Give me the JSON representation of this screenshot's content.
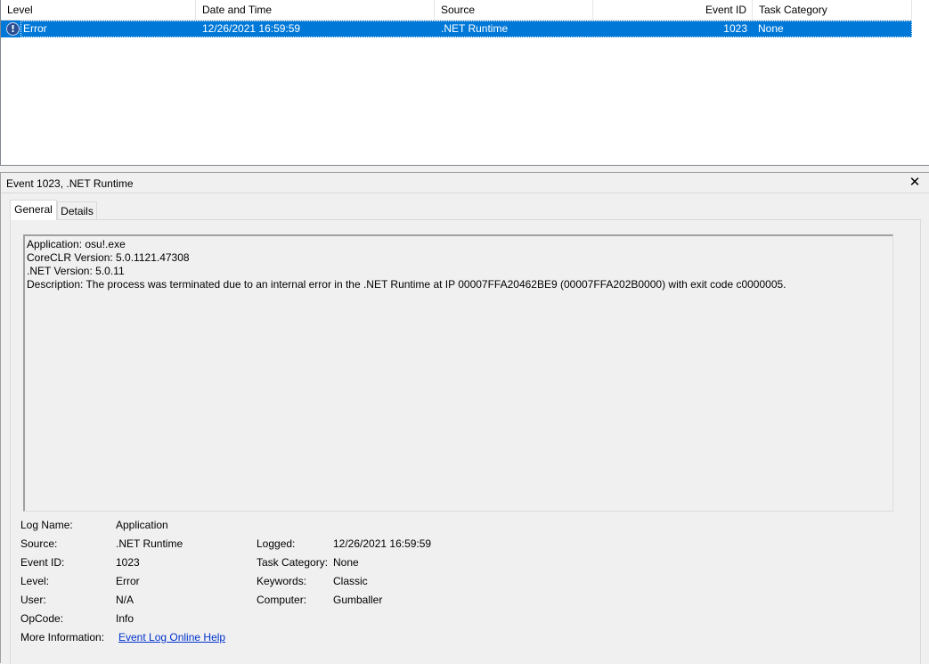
{
  "list": {
    "columns": [
      "Level",
      "Date and Time",
      "Source",
      "Event ID",
      "Task Category"
    ],
    "rows": [
      {
        "level": "Error",
        "level_icon": "error-info-icon",
        "date_time": "12/26/2021 16:59:59",
        "source": ".NET Runtime",
        "event_id": "1023",
        "task_category": "None"
      }
    ],
    "selection_color": "#0078d7"
  },
  "detail": {
    "title": "Event 1023, .NET Runtime",
    "close_glyph": "✕",
    "tabs": [
      "General",
      "Details"
    ],
    "active_tab": "General",
    "description_lines": [
      "Application: osu!.exe",
      "CoreCLR Version: 5.0.1121.47308",
      ".NET Version: 5.0.11",
      "Description: The process was terminated due to an internal error in the .NET Runtime at IP 00007FFA20462BE9 (00007FFA202B0000) with exit code c0000005."
    ],
    "properties": {
      "log_name": {
        "label": "Log Name:",
        "value": "Application"
      },
      "source": {
        "label": "Source:",
        "value": ".NET Runtime"
      },
      "logged": {
        "label": "Logged:",
        "value": "12/26/2021 16:59:59"
      },
      "event_id": {
        "label": "Event ID:",
        "value": "1023"
      },
      "task_category": {
        "label": "Task Category:",
        "value": "None"
      },
      "level": {
        "label": "Level:",
        "value": "Error"
      },
      "keywords": {
        "label": "Keywords:",
        "value": "Classic"
      },
      "user": {
        "label": "User:",
        "value": "N/A"
      },
      "computer": {
        "label": "Computer:",
        "value": "Gumballer"
      },
      "opcode": {
        "label": "OpCode:",
        "value": "Info"
      },
      "more_info": {
        "label": "More Information:",
        "value": "Event Log Online Help"
      }
    }
  }
}
